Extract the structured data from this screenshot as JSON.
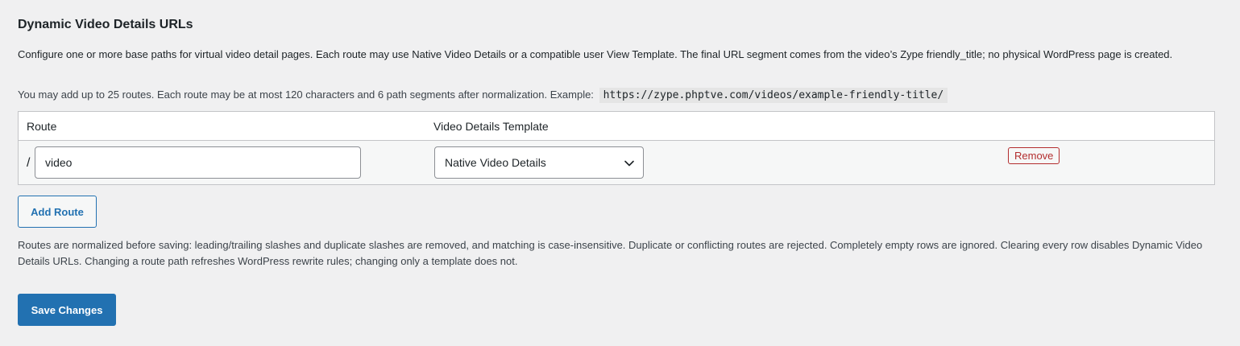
{
  "section": {
    "title": "Dynamic Video Details URLs",
    "description": "Configure one or more base paths for virtual video detail pages. Each route may use Native Video Details or a compatible user View Template. The final URL segment comes from the video’s Zype friendly_title; no physical WordPress page is created.",
    "limits_text": "You may add up to 25 routes. Each route may be at most 120 characters and 6 path segments after normalization. Example:",
    "example_url": "https://zype.phptve.com/videos/example-friendly-title/"
  },
  "table": {
    "columns": [
      "Route",
      "Video Details Template"
    ],
    "rows": [
      {
        "prefix": "/",
        "route_value": "video",
        "template_selected": "Native Video Details",
        "remove_label": "Remove"
      }
    ]
  },
  "actions": {
    "add_route_label": "Add Route",
    "save_label": "Save Changes"
  },
  "notes": "Routes are normalized before saving: leading/trailing slashes and duplicate slashes are removed, and matching is case-insensitive. Duplicate or conflicting routes are rejected. Completely empty rows are ignored. Clearing every row disables Dynamic Video Details URLs. Changing a route path refreshes WordPress rewrite rules; changing only a template does not.",
  "icons": {
    "select_arrow": "chevron-down-icon"
  },
  "colors": {
    "page_background": "#f0f0f1",
    "primary": "#2271b1",
    "danger": "#b32d2e",
    "row_background": "#f6f7f7",
    "border": "#c3c4c7"
  }
}
